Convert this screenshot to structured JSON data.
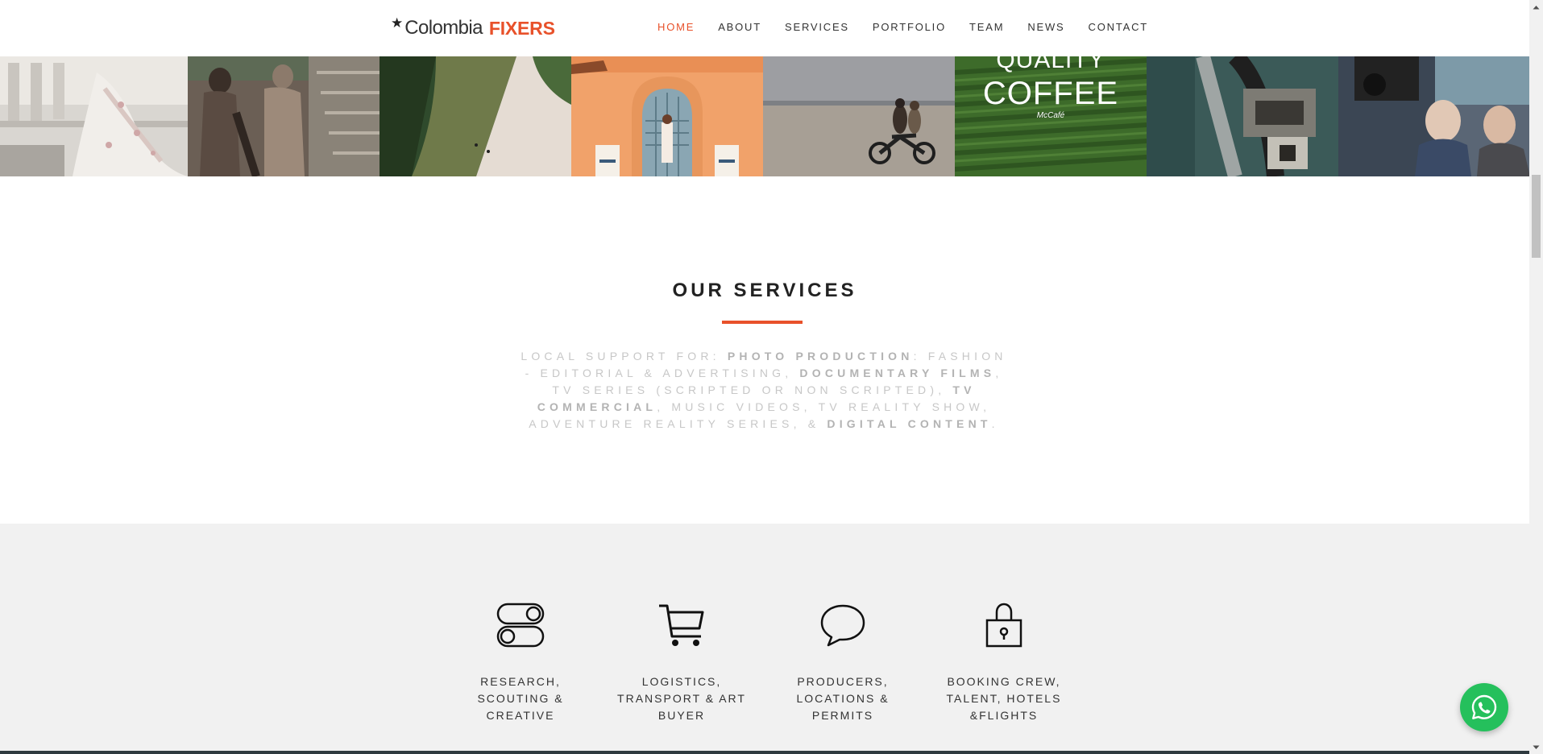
{
  "header": {
    "logo": {
      "star": "★",
      "brand_main": "Colombia",
      "brand_accent": "FIXERS"
    },
    "nav": [
      {
        "label": "HOME",
        "active": true
      },
      {
        "label": "ABOUT",
        "active": false
      },
      {
        "label": "SERVICES",
        "active": false
      },
      {
        "label": "PORTFOLIO",
        "active": false
      },
      {
        "label": "TEAM",
        "active": false
      },
      {
        "label": "NEWS",
        "active": false
      },
      {
        "label": "CONTACT",
        "active": false
      }
    ]
  },
  "gallery": {
    "tiles": [
      {
        "subject": "fashion-model-in-floral-dress"
      },
      {
        "subject": "painted-models-on-stairs"
      },
      {
        "subject": "aerial-river"
      },
      {
        "subject": "woman-at-orange-doorway"
      },
      {
        "subject": "motorcycle-on-beach"
      },
      {
        "subject": "coffee-plantation-ad",
        "caption_line1": "QUALITY",
        "caption_line2": "COFFEE",
        "caption_brand": "McCafé"
      },
      {
        "subject": "camera-equipment-closeup"
      },
      {
        "subject": "film-crew-with-camera"
      }
    ]
  },
  "services": {
    "title": "OUR SERVICES",
    "intro_parts": [
      {
        "text": "LOCAL SUPPORT FOR: ",
        "bold": false
      },
      {
        "text": "PHOTO PRODUCTION",
        "bold": true
      },
      {
        "text": ": FASHION - EDITORIAL & ADVERTISING, ",
        "bold": false
      },
      {
        "text": "DOCUMENTARY FILMS",
        "bold": true
      },
      {
        "text": ", TV SERIES (SCRIPTED OR NON SCRIPTED), ",
        "bold": false
      },
      {
        "text": "TV COMMERCIAL",
        "bold": true
      },
      {
        "text": ", MUSIC VIDEOS, TV REALITY SHOW, ADVENTURE REALITY SERIES, & ",
        "bold": false
      },
      {
        "text": "DIGITAL CONTENT",
        "bold": true
      },
      {
        "text": ".",
        "bold": false
      }
    ],
    "features": [
      {
        "icon": "toggle-icon",
        "label": "RESEARCH, SCOUTING & CREATIVE"
      },
      {
        "icon": "shopping-cart-icon",
        "label": "LOGISTICS, TRANSPORT & ART BUYER"
      },
      {
        "icon": "speech-bubble-icon",
        "label": "PRODUCERS, LOCATIONS & PERMITS"
      },
      {
        "icon": "padlock-icon",
        "label": "BOOKING CREW, TALENT, HOTELS &FLIGHTS"
      }
    ]
  },
  "whatsapp": {
    "icon": "whatsapp-icon"
  },
  "colors": {
    "accent": "#e8512a",
    "nav_text": "#333333",
    "intro_text": "#c7c7c7",
    "features_bg": "#f1f1f1",
    "whatsapp": "#25c05c"
  }
}
